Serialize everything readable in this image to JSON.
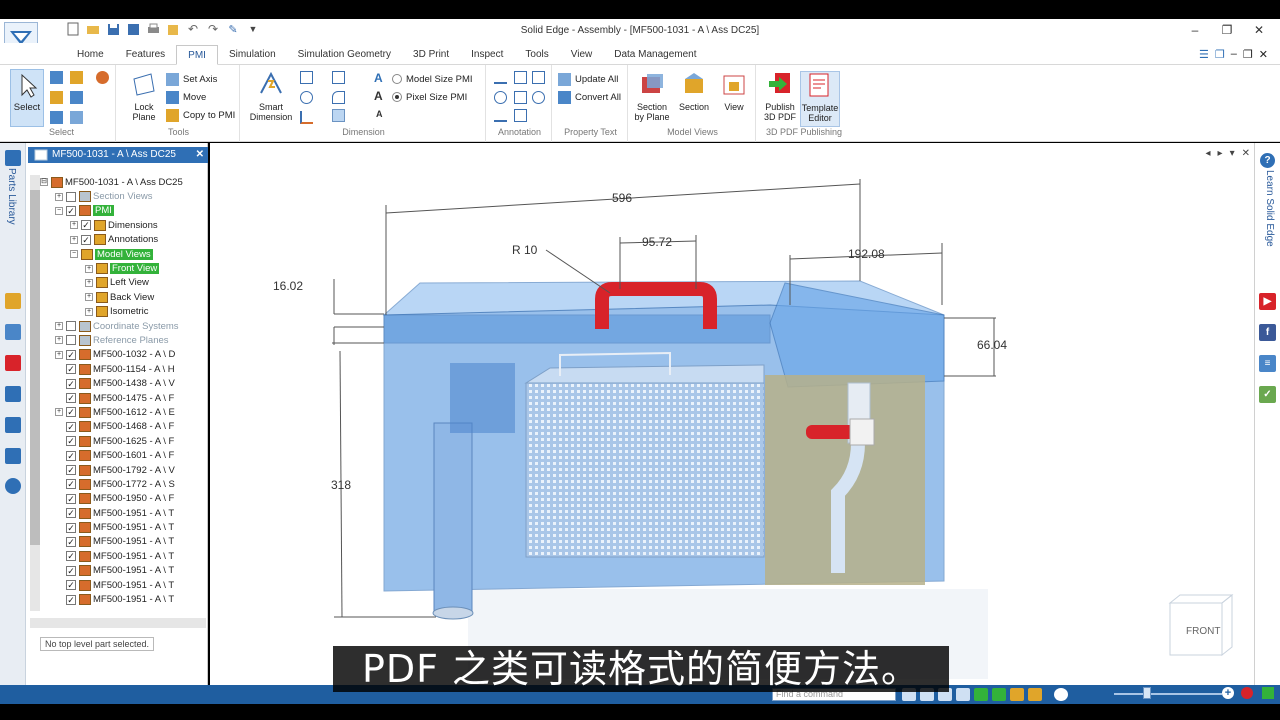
{
  "window": {
    "title": "Solid Edge - Assembly - [MF500-1031 - A \\ Ass DC25]",
    "controls": [
      "–",
      "❐",
      "✕"
    ]
  },
  "tabs": [
    "Home",
    "Features",
    "PMI",
    "Simulation",
    "Simulation Geometry",
    "3D Print",
    "Inspect",
    "Tools",
    "View",
    "Data Management"
  ],
  "active_tab": "PMI",
  "ribbon": {
    "select": {
      "label": "Select",
      "group": "Select"
    },
    "tools": {
      "lock_plane": "Lock Plane",
      "set_axis": "Set Axis",
      "move": "Move",
      "copy_to_pmi": "Copy to PMI",
      "group": "Tools"
    },
    "dimension": {
      "smart_dimension": "Smart Dimension",
      "model_size_pmi": "Model Size PMI",
      "pixel_size_pmi": "Pixel Size PMI",
      "group": "Dimension"
    },
    "annotation": {
      "group": "Annotation"
    },
    "property_text": {
      "update_all": "Update All",
      "convert_all": "Convert All",
      "group": "Property Text"
    },
    "model_views": {
      "section_by_plane": "Section by Plane",
      "section": "Section",
      "view": "View",
      "group": "Model Views"
    },
    "publishing": {
      "publish_3d_pdf": "Publish 3D PDF",
      "template_editor": "Template Editor",
      "group": "3D PDF Publishing"
    }
  },
  "left_strip": {
    "parts_library": "Parts Library"
  },
  "right_strip": {
    "learn": "Learn Solid Edge"
  },
  "document_tab": "MF500-1031 - A \\ Ass DC25",
  "tree": [
    {
      "text": "MF500-1031 - A \\ Ass DC25",
      "indent": 0,
      "exp": "⊟",
      "chk": false,
      "hl": false,
      "muted": false
    },
    {
      "text": "Section Views",
      "indent": 1,
      "exp": "+",
      "chk": "empty",
      "hl": false,
      "muted": true
    },
    {
      "text": "PMI",
      "indent": 1,
      "exp": "−",
      "chk": "checked",
      "hl": true,
      "muted": false
    },
    {
      "text": "Dimensions",
      "indent": 2,
      "exp": "+",
      "chk": "checked",
      "hl": false,
      "muted": false
    },
    {
      "text": "Annotations",
      "indent": 2,
      "exp": "+",
      "chk": "checked",
      "hl": false,
      "muted": false
    },
    {
      "text": "Model Views",
      "indent": 2,
      "exp": "−",
      "chk": false,
      "hl": true,
      "muted": false
    },
    {
      "text": "Front View",
      "indent": 3,
      "exp": "+",
      "chk": false,
      "hl": true,
      "muted": false
    },
    {
      "text": "Left View",
      "indent": 3,
      "exp": "+",
      "chk": false,
      "hl": false,
      "muted": false
    },
    {
      "text": "Back View",
      "indent": 3,
      "exp": "+",
      "chk": false,
      "hl": false,
      "muted": false
    },
    {
      "text": "Isometric",
      "indent": 3,
      "exp": "+",
      "chk": false,
      "hl": false,
      "muted": false
    },
    {
      "text": "Coordinate Systems",
      "indent": 1,
      "exp": "+",
      "chk": "empty",
      "hl": false,
      "muted": true
    },
    {
      "text": "Reference Planes",
      "indent": 1,
      "exp": "+",
      "chk": "empty",
      "hl": false,
      "muted": true
    },
    {
      "text": "MF500-1032 - A \\ D",
      "indent": 1,
      "exp": "+",
      "chk": "checked",
      "hl": false,
      "muted": false
    },
    {
      "text": "MF500-1154 - A \\ H",
      "indent": 1,
      "exp": "",
      "chk": "checked",
      "hl": false,
      "muted": false
    },
    {
      "text": "MF500-1438 - A \\ V",
      "indent": 1,
      "exp": "",
      "chk": "checked",
      "hl": false,
      "muted": false
    },
    {
      "text": "MF500-1475 - A \\ F",
      "indent": 1,
      "exp": "",
      "chk": "checked",
      "hl": false,
      "muted": false
    },
    {
      "text": "MF500-1612 - A \\ E",
      "indent": 1,
      "exp": "+",
      "chk": "checked",
      "hl": false,
      "muted": false
    },
    {
      "text": "MF500-1468 - A \\ F",
      "indent": 1,
      "exp": "",
      "chk": "checked",
      "hl": false,
      "muted": false
    },
    {
      "text": "MF500-1625 - A \\ F",
      "indent": 1,
      "exp": "",
      "chk": "checked",
      "hl": false,
      "muted": false
    },
    {
      "text": "MF500-1601 - A \\ F",
      "indent": 1,
      "exp": "",
      "chk": "checked",
      "hl": false,
      "muted": false
    },
    {
      "text": "MF500-1792 - A \\ V",
      "indent": 1,
      "exp": "",
      "chk": "checked",
      "hl": false,
      "muted": false
    },
    {
      "text": "MF500-1772 - A \\ S",
      "indent": 1,
      "exp": "",
      "chk": "checked",
      "hl": false,
      "muted": false
    },
    {
      "text": "MF500-1950 - A \\ F",
      "indent": 1,
      "exp": "",
      "chk": "checked",
      "hl": false,
      "muted": false
    },
    {
      "text": "MF500-1951 - A \\ T",
      "indent": 1,
      "exp": "",
      "chk": "checked",
      "hl": false,
      "muted": false
    },
    {
      "text": "MF500-1951 - A \\ T",
      "indent": 1,
      "exp": "",
      "chk": "checked",
      "hl": false,
      "muted": false
    },
    {
      "text": "MF500-1951 - A \\ T",
      "indent": 1,
      "exp": "",
      "chk": "checked",
      "hl": false,
      "muted": false
    },
    {
      "text": "MF500-1951 - A \\ T",
      "indent": 1,
      "exp": "",
      "chk": "checked",
      "hl": false,
      "muted": false
    },
    {
      "text": "MF500-1951 - A \\ T",
      "indent": 1,
      "exp": "",
      "chk": "checked",
      "hl": false,
      "muted": false
    },
    {
      "text": "MF500-1951 - A \\ T",
      "indent": 1,
      "exp": "",
      "chk": "checked",
      "hl": false,
      "muted": false
    },
    {
      "text": "MF500-1951 - A \\ T",
      "indent": 1,
      "exp": "",
      "chk": "checked",
      "hl": false,
      "muted": false
    }
  ],
  "status_text": "No top level part selected.",
  "dimensions": {
    "overall": "596",
    "radius": "R 10",
    "handle": "95.72",
    "right": "192.08",
    "top": "16.02",
    "lid": "66.04",
    "height": "318"
  },
  "view_cube": "FRONT",
  "find_placeholder": "Find a command",
  "subtitle": "PDF 之类可读格式的简便方法。",
  "colors": {
    "accent": "#2f6fb5",
    "tank": "#5b9be0",
    "handle": "#d8232a",
    "highlight": "#33b23a"
  }
}
